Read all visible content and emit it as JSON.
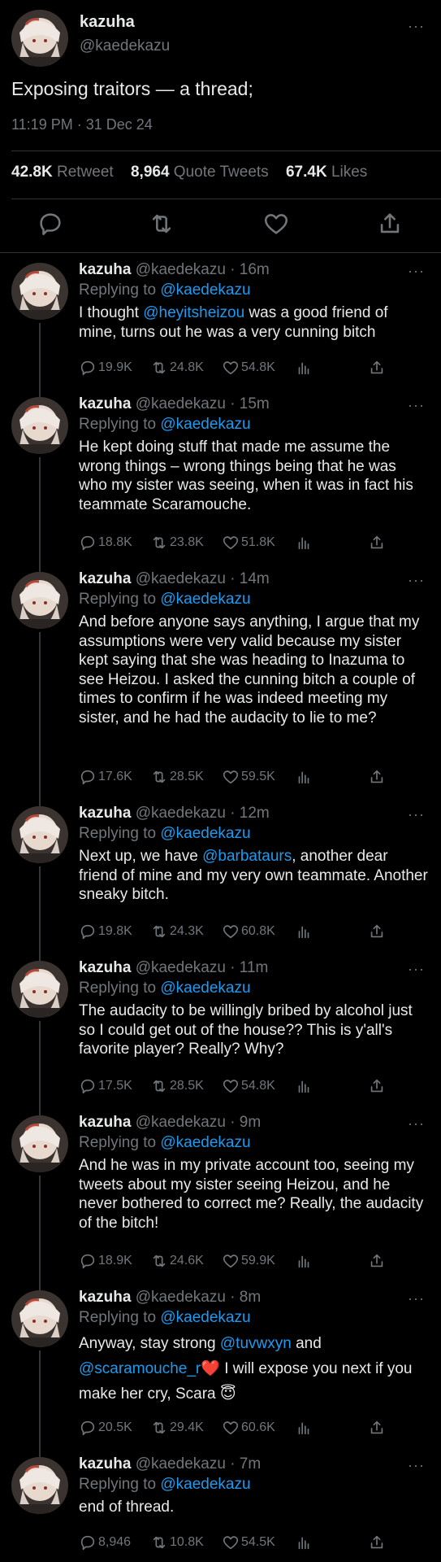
{
  "main_tweet": {
    "name": "kazuha",
    "handle": "@kaedekazu",
    "text": "Exposing traitors — a thread;",
    "timestamp": "11:19 PM · 31 Dec 24",
    "retweets": "42.8K",
    "retweets_label": "Retweet",
    "quote_tweets": "8,964",
    "quote_tweets_label": "Quote Tweets",
    "likes": "67.4K",
    "likes_label": "Likes",
    "more": "···"
  },
  "replies": [
    {
      "name": "kazuha",
      "handle": "@kaedekazu",
      "age": "16m",
      "replying_prefix": "Replying to",
      "replying_to": "@kaedekazu",
      "text_a": "I thought ",
      "mention_a": "@heyitsheizou",
      "text_b": " was a good friend of mine, turns out he was a very cunning bitch",
      "replies": "19.9K",
      "retweets": "24.8K",
      "likes": "54.8K"
    },
    {
      "name": "kazuha",
      "handle": "@kaedekazu",
      "age": "15m",
      "replying_prefix": "Replying to",
      "replying_to": "@kaedekazu",
      "text_a": "He kept doing stuff that made me assume the wrong things – wrong things being that he was who my sister was seeing, when it was in fact his teammate Scaramouche.",
      "replies": "18.8K",
      "retweets": "23.8K",
      "likes": "51.8K"
    },
    {
      "name": "kazuha",
      "handle": "@kaedekazu",
      "age": "14m",
      "replying_prefix": "Replying to",
      "replying_to": "@kaedekazu",
      "text_a": "And before anyone says anything, I argue that my assumptions were very valid because my sister kept saying that she was heading to Inazuma to see Heizou. I asked the cunning bitch a couple of times to confirm if he was indeed meeting my sister, and he had the audacity to lie to me?",
      "replies": "17.6K",
      "retweets": "28.5K",
      "likes": "59.5K"
    },
    {
      "name": "kazuha",
      "handle": "@kaedekazu",
      "age": "12m",
      "replying_prefix": "Replying to",
      "replying_to": "@kaedekazu",
      "text_a": "Next up, we have ",
      "mention_a": "@barbataurs",
      "text_b": ", another dear friend of mine and my very own teammate. Another sneaky bitch.",
      "replies": "19.8K",
      "retweets": "24.3K",
      "likes": "60.8K"
    },
    {
      "name": "kazuha",
      "handle": "@kaedekazu",
      "age": "11m",
      "replying_prefix": "Replying to",
      "replying_to": "@kaedekazu",
      "text_a": "The audacity to be willingly bribed by alcohol just so I could get out of the house?? This is y'all's favorite player? Really? Why?",
      "replies": "17.5K",
      "retweets": "28.5K",
      "likes": "54.8K"
    },
    {
      "name": "kazuha",
      "handle": "@kaedekazu",
      "age": "9m",
      "replying_prefix": "Replying to",
      "replying_to": "@kaedekazu",
      "text_a": "And he was in my private account too, seeing my tweets about my sister seeing Heizou, and he never bothered to correct me? Really, the audacity of the bitch!",
      "replies": "18.9K",
      "retweets": "24.6K",
      "likes": "59.9K"
    },
    {
      "name": "kazuha",
      "handle": "@kaedekazu",
      "age": "8m",
      "replying_prefix": "Replying to",
      "replying_to": "@kaedekazu",
      "text_a": "Anyway, stay strong ",
      "mention_a": "@tuvwxyn",
      "text_b": " and ",
      "mention_b": "@scaramouche_r",
      "heart": "❤️",
      "text_c": " I will expose you next if you make her cry, Scara ",
      "emoji": "😇",
      "replies": "20.5K",
      "retweets": "29.4K",
      "likes": "60.6K"
    },
    {
      "name": "kazuha",
      "handle": "@kaedekazu",
      "age": "7m",
      "replying_prefix": "Replying to",
      "replying_to": "@kaedekazu",
      "text_a": "end of thread.",
      "replies": "8,946",
      "retweets": "10.8K",
      "likes": "54.5K"
    }
  ],
  "icons": {
    "reply": "speech-bubble-icon",
    "retweet": "retweet-arrows-icon",
    "like": "heart-icon",
    "analytics": "bar-chart-icon",
    "share": "share-upload-icon",
    "more": "more-dots-icon"
  },
  "colors": {
    "background": "#000000",
    "text": "#e7e9ea",
    "muted": "#71767b",
    "link": "#1d9bf0",
    "divider": "#2f3336"
  }
}
